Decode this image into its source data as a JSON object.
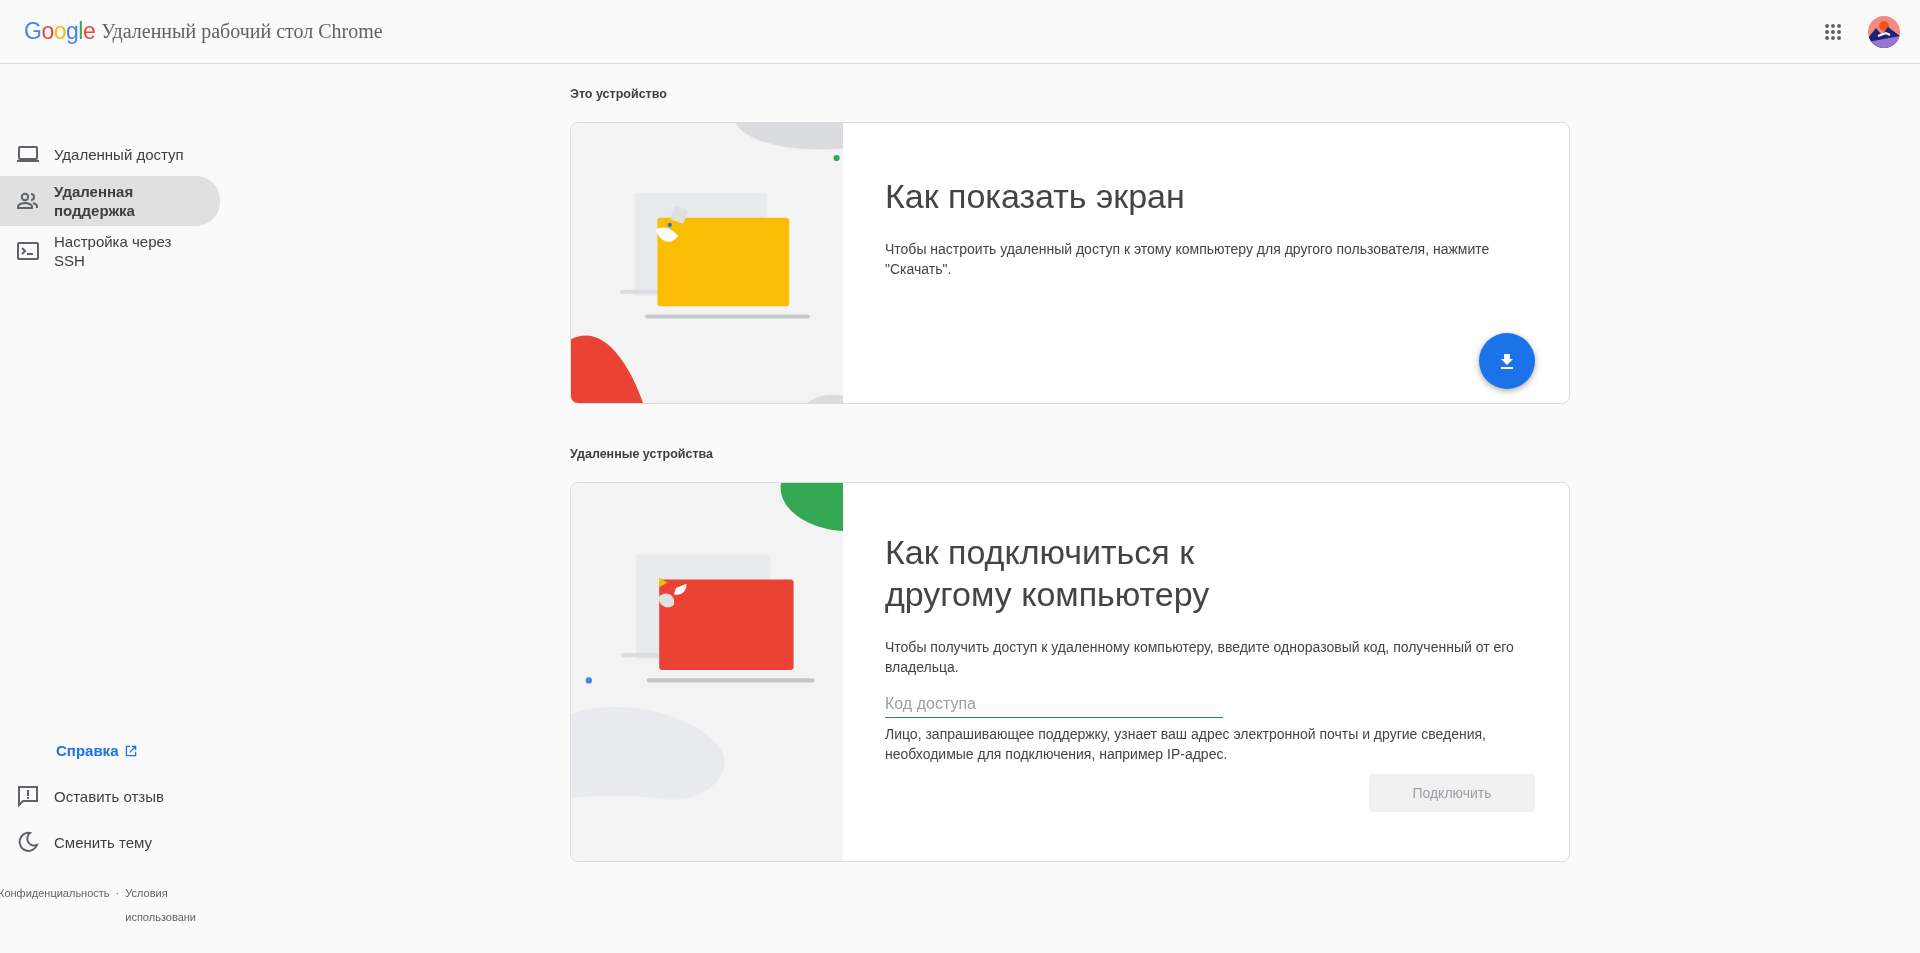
{
  "header": {
    "logo": "Google",
    "title": "Удаленный рабочий стол Chrome"
  },
  "sidebar": {
    "items": [
      {
        "label": "Удаленный доступ",
        "selected": false
      },
      {
        "label": "Удаленная поддержка",
        "selected": true
      },
      {
        "label": "Настройка через SSH",
        "selected": false
      }
    ],
    "help_link": "Справка",
    "actions": [
      "Оставить отзыв",
      "Сменить тему"
    ],
    "footer": {
      "privacy": "Конфиденциальность",
      "separator": "·",
      "terms": "Условия использовани"
    }
  },
  "sections": [
    {
      "heading": "Это устройство",
      "card": {
        "kind": "share",
        "title": "Как показать экран",
        "text": "Чтобы настроить удаленный доступ к этому компьютеру для другого пользователя, нажмите \"Скачать\"."
      }
    },
    {
      "heading": "Удаленные устройства",
      "card": {
        "kind": "connect",
        "title": "Как подключиться к другому компьютеру",
        "text": "Чтобы получить доступ к удаленному компьютеру, введите одноразовый код, полученный от его владельца.",
        "field": {
          "placeholder": "Код доступа"
        },
        "note": "Лицо, запрашивающее поддержку, узнает ваш адрес электронной почты и другие сведения, необходимые для подключения, например IP-адрес.",
        "button": {
          "label": "Подключить",
          "disabled": true
        }
      }
    }
  ]
}
